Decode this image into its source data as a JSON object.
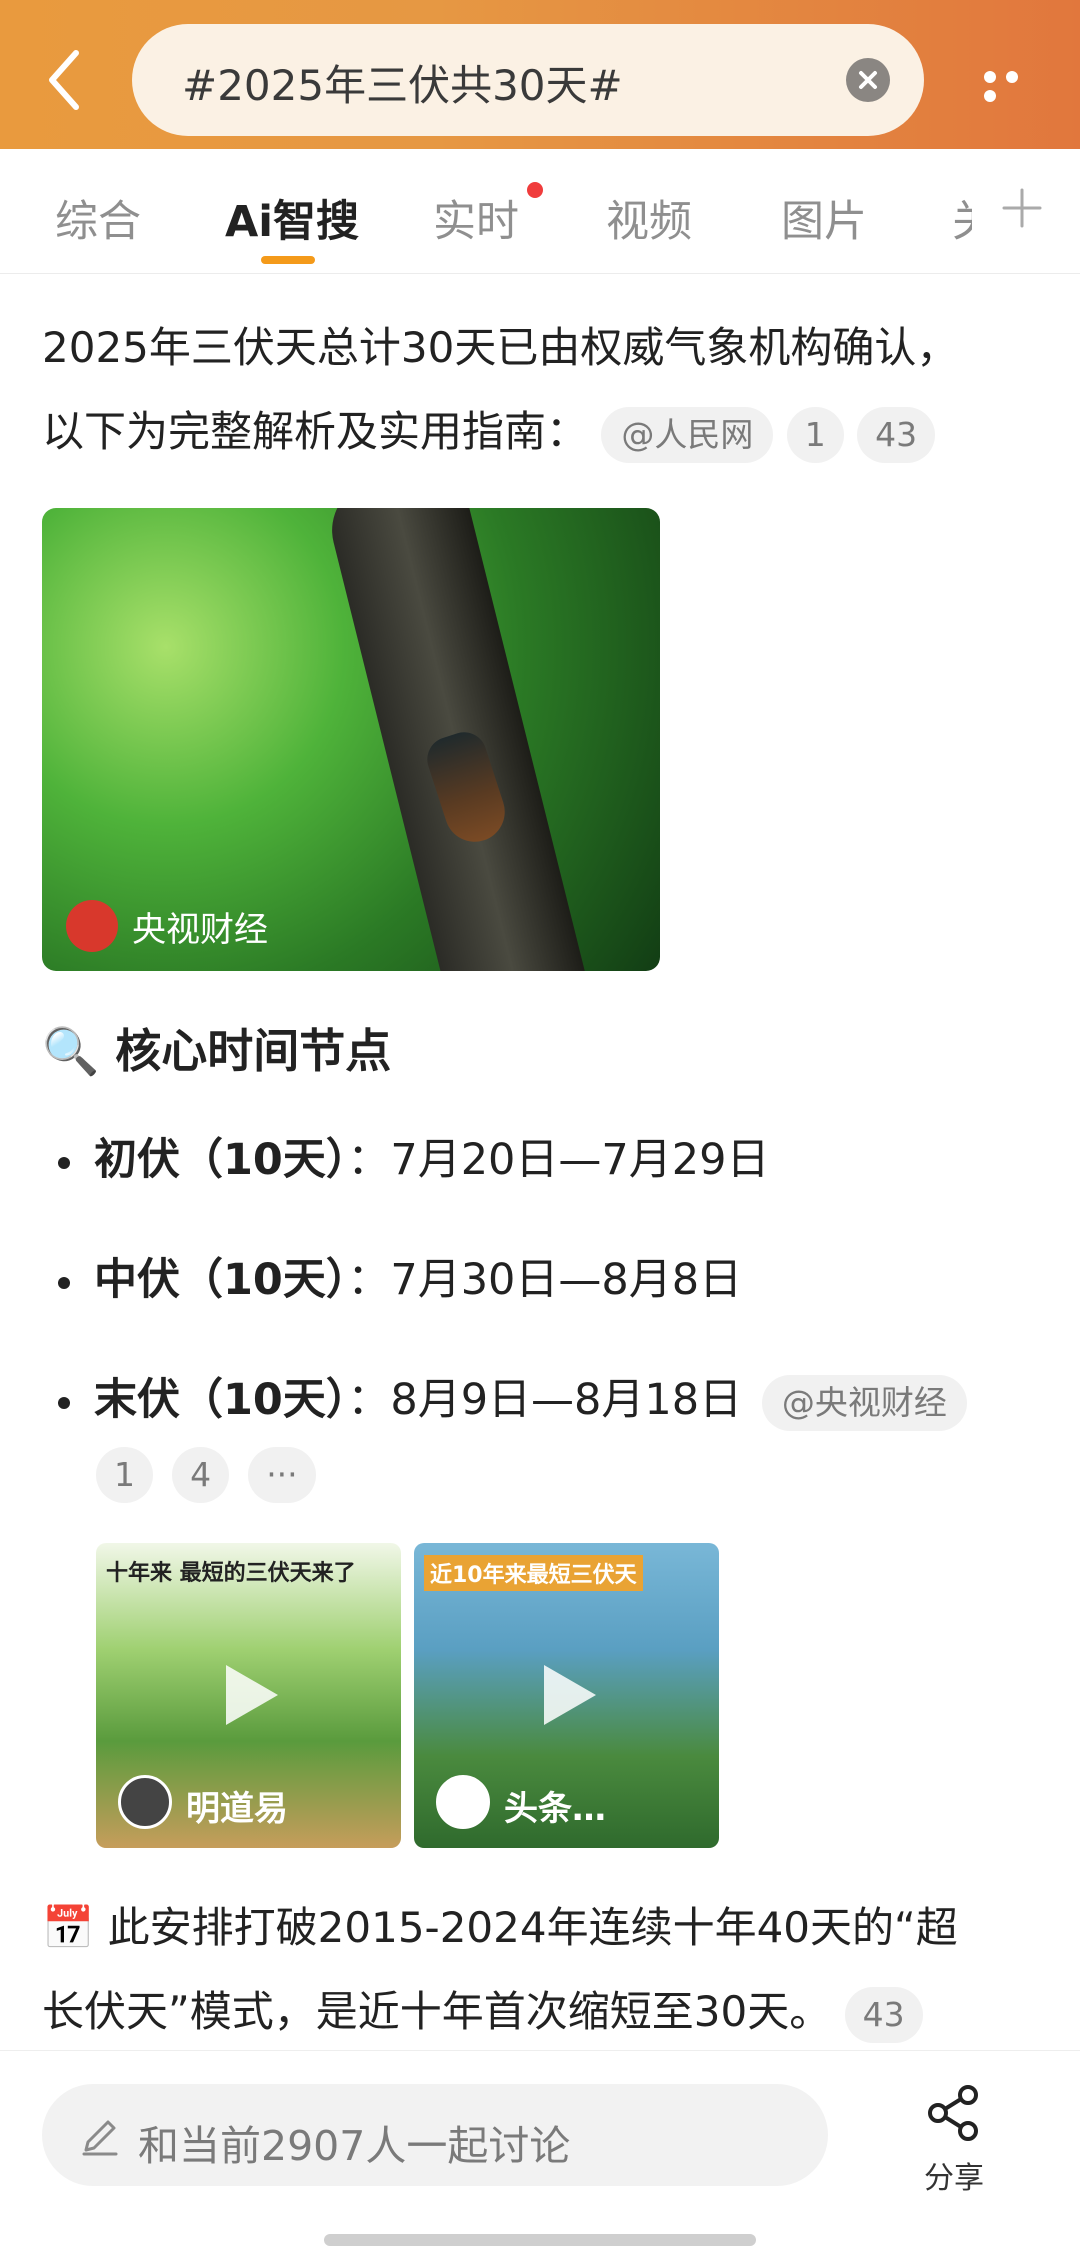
{
  "header": {
    "search_query": "#2025年三伏共30天#"
  },
  "tabs": [
    {
      "label": "综合",
      "active": false
    },
    {
      "label": "Ai智搜",
      "active": true
    },
    {
      "label": "实时",
      "active": false,
      "badge": "red-dot"
    },
    {
      "label": "视频",
      "active": false
    },
    {
      "label": "图片",
      "active": false
    },
    {
      "label": "关",
      "active": false
    }
  ],
  "intro": {
    "line1": "2025年三伏天总计30天已由权威气象机构确认，",
    "line2": "以下为完整解析及实用指南：",
    "source": "@人民网",
    "ref1": "1",
    "ref2": "43"
  },
  "image": {
    "source_label": "央视财经",
    "badge_text": "央视财经"
  },
  "section": {
    "emoji": "🔍",
    "title": "核心时间节点"
  },
  "periods": [
    {
      "name": "初伏（10天）",
      "sep": "：",
      "range": "7月20日—7月29日"
    },
    {
      "name": "中伏（10天）",
      "sep": "：",
      "range": "7月30日—8月8日"
    },
    {
      "name": "末伏（10天）",
      "sep": "：",
      "range": "8月9日—8月18日"
    }
  ],
  "period_source": "@央视财经",
  "period_refs": [
    "1",
    "4",
    "···"
  ],
  "videos": [
    {
      "title": "明道易",
      "overlay_top": "十年来 最短的三伏天来了"
    },
    {
      "title": "头条…",
      "overlay_top": "近10年来最短三伏天"
    }
  ],
  "note": {
    "emoji": "📅",
    "line1": "此安排打破2015-2024年连续十年40天的“超",
    "line2": "长伏天”模式，是近十年首次缩短至30天。",
    "ref": "43"
  },
  "bottom": {
    "comment_placeholder": "和当前2907人一起讨论",
    "share_label": "分享"
  },
  "colors": {
    "header_gradient_start": "#e99a3e",
    "header_gradient_end": "#e1773d",
    "tab_active_underline": "#f49a1a",
    "badge_red": "#f03c3c"
  }
}
